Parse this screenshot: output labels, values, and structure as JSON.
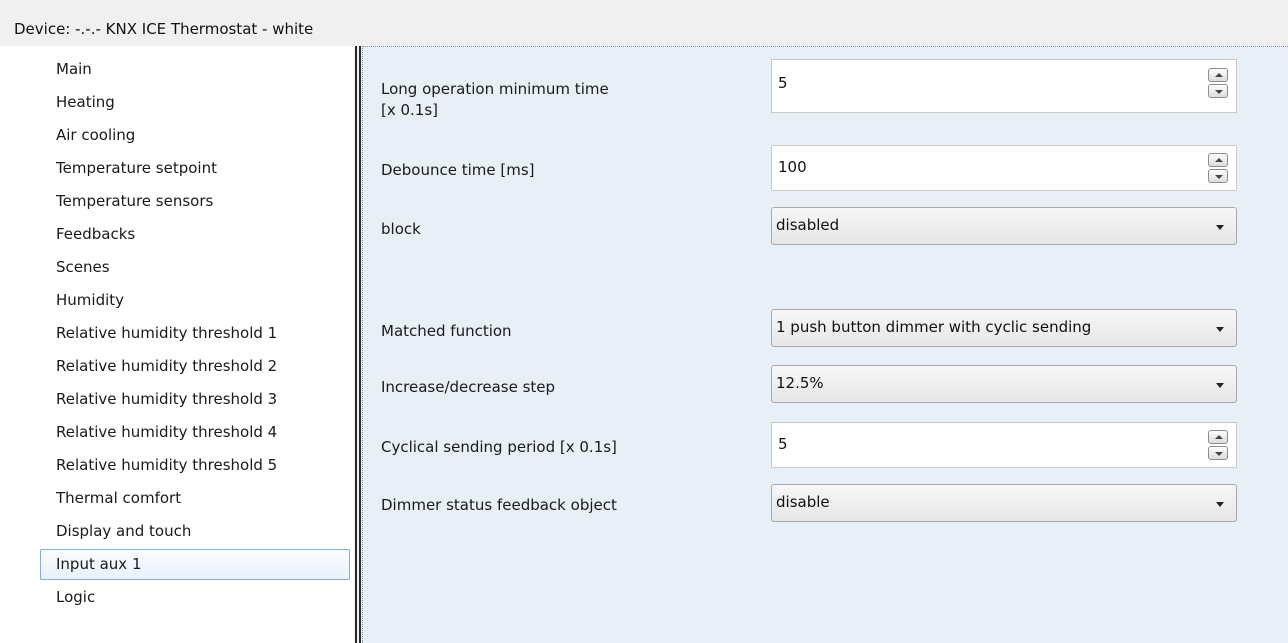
{
  "window": {
    "title": "Device: -.-.-  KNX ICE Thermostat - white"
  },
  "sidebar": {
    "items": [
      {
        "label": "Main"
      },
      {
        "label": "Heating"
      },
      {
        "label": "Air cooling"
      },
      {
        "label": "Temperature setpoint"
      },
      {
        "label": "Temperature sensors"
      },
      {
        "label": "Feedbacks"
      },
      {
        "label": "Scenes"
      },
      {
        "label": "Humidity"
      },
      {
        "label": "Relative humidity threshold 1"
      },
      {
        "label": "Relative humidity threshold 2"
      },
      {
        "label": "Relative humidity threshold 3"
      },
      {
        "label": "Relative humidity threshold 4"
      },
      {
        "label": "Relative humidity threshold 5"
      },
      {
        "label": "Thermal comfort"
      },
      {
        "label": "Display and touch"
      },
      {
        "label": "Input aux 1"
      },
      {
        "label": "Logic"
      }
    ],
    "selected_label": "Input aux 1"
  },
  "params": {
    "long_op": {
      "label": "Long operation minimum time\n[x 0.1s]",
      "value": "5"
    },
    "debounce": {
      "label": "Debounce time [ms]",
      "value": "100"
    },
    "block": {
      "label": "block",
      "value": "disabled"
    },
    "matched": {
      "label": "Matched function",
      "value": "1 push button dimmer with cyclic sending"
    },
    "step": {
      "label": "Increase/decrease step",
      "value": "12.5%"
    },
    "cyclical": {
      "label": "Cyclical sending period [x 0.1s]",
      "value": "5"
    },
    "dimmer_feedback": {
      "label": "Dimmer status feedback object",
      "value": "disable"
    }
  },
  "colors": {
    "content_bg": "#e9eff7",
    "selected_border": "#84acdd"
  }
}
